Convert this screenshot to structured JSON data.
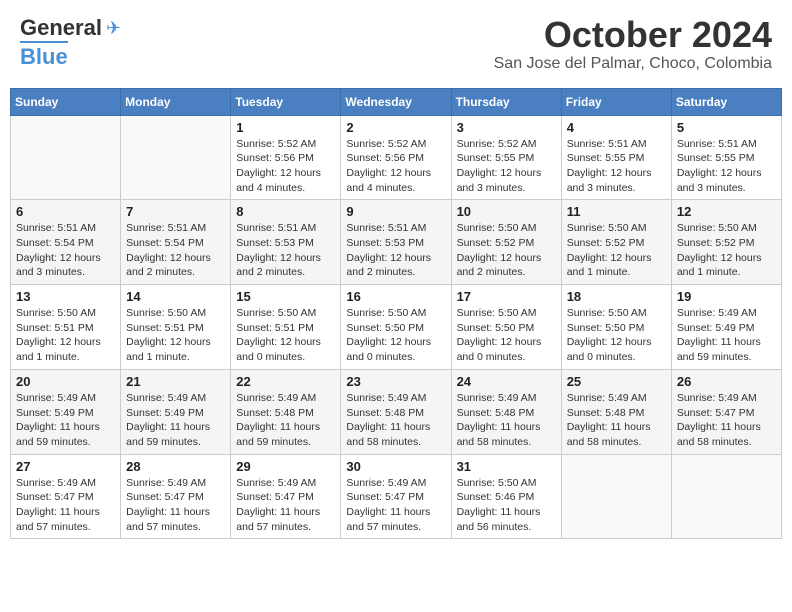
{
  "logo": {
    "line1": "General",
    "line2": "Blue"
  },
  "title": "October 2024",
  "subtitle": "San Jose del Palmar, Choco, Colombia",
  "days_of_week": [
    "Sunday",
    "Monday",
    "Tuesday",
    "Wednesday",
    "Thursday",
    "Friday",
    "Saturday"
  ],
  "weeks": [
    [
      {
        "day": "",
        "info": ""
      },
      {
        "day": "",
        "info": ""
      },
      {
        "day": "1",
        "info": "Sunrise: 5:52 AM\nSunset: 5:56 PM\nDaylight: 12 hours\nand 4 minutes."
      },
      {
        "day": "2",
        "info": "Sunrise: 5:52 AM\nSunset: 5:56 PM\nDaylight: 12 hours\nand 4 minutes."
      },
      {
        "day": "3",
        "info": "Sunrise: 5:52 AM\nSunset: 5:55 PM\nDaylight: 12 hours\nand 3 minutes."
      },
      {
        "day": "4",
        "info": "Sunrise: 5:51 AM\nSunset: 5:55 PM\nDaylight: 12 hours\nand 3 minutes."
      },
      {
        "day": "5",
        "info": "Sunrise: 5:51 AM\nSunset: 5:55 PM\nDaylight: 12 hours\nand 3 minutes."
      }
    ],
    [
      {
        "day": "6",
        "info": "Sunrise: 5:51 AM\nSunset: 5:54 PM\nDaylight: 12 hours\nand 3 minutes."
      },
      {
        "day": "7",
        "info": "Sunrise: 5:51 AM\nSunset: 5:54 PM\nDaylight: 12 hours\nand 2 minutes."
      },
      {
        "day": "8",
        "info": "Sunrise: 5:51 AM\nSunset: 5:53 PM\nDaylight: 12 hours\nand 2 minutes."
      },
      {
        "day": "9",
        "info": "Sunrise: 5:51 AM\nSunset: 5:53 PM\nDaylight: 12 hours\nand 2 minutes."
      },
      {
        "day": "10",
        "info": "Sunrise: 5:50 AM\nSunset: 5:52 PM\nDaylight: 12 hours\nand 2 minutes."
      },
      {
        "day": "11",
        "info": "Sunrise: 5:50 AM\nSunset: 5:52 PM\nDaylight: 12 hours\nand 1 minute."
      },
      {
        "day": "12",
        "info": "Sunrise: 5:50 AM\nSunset: 5:52 PM\nDaylight: 12 hours\nand 1 minute."
      }
    ],
    [
      {
        "day": "13",
        "info": "Sunrise: 5:50 AM\nSunset: 5:51 PM\nDaylight: 12 hours\nand 1 minute."
      },
      {
        "day": "14",
        "info": "Sunrise: 5:50 AM\nSunset: 5:51 PM\nDaylight: 12 hours\nand 1 minute."
      },
      {
        "day": "15",
        "info": "Sunrise: 5:50 AM\nSunset: 5:51 PM\nDaylight: 12 hours\nand 0 minutes."
      },
      {
        "day": "16",
        "info": "Sunrise: 5:50 AM\nSunset: 5:50 PM\nDaylight: 12 hours\nand 0 minutes."
      },
      {
        "day": "17",
        "info": "Sunrise: 5:50 AM\nSunset: 5:50 PM\nDaylight: 12 hours\nand 0 minutes."
      },
      {
        "day": "18",
        "info": "Sunrise: 5:50 AM\nSunset: 5:50 PM\nDaylight: 12 hours\nand 0 minutes."
      },
      {
        "day": "19",
        "info": "Sunrise: 5:49 AM\nSunset: 5:49 PM\nDaylight: 11 hours\nand 59 minutes."
      }
    ],
    [
      {
        "day": "20",
        "info": "Sunrise: 5:49 AM\nSunset: 5:49 PM\nDaylight: 11 hours\nand 59 minutes."
      },
      {
        "day": "21",
        "info": "Sunrise: 5:49 AM\nSunset: 5:49 PM\nDaylight: 11 hours\nand 59 minutes."
      },
      {
        "day": "22",
        "info": "Sunrise: 5:49 AM\nSunset: 5:48 PM\nDaylight: 11 hours\nand 59 minutes."
      },
      {
        "day": "23",
        "info": "Sunrise: 5:49 AM\nSunset: 5:48 PM\nDaylight: 11 hours\nand 58 minutes."
      },
      {
        "day": "24",
        "info": "Sunrise: 5:49 AM\nSunset: 5:48 PM\nDaylight: 11 hours\nand 58 minutes."
      },
      {
        "day": "25",
        "info": "Sunrise: 5:49 AM\nSunset: 5:48 PM\nDaylight: 11 hours\nand 58 minutes."
      },
      {
        "day": "26",
        "info": "Sunrise: 5:49 AM\nSunset: 5:47 PM\nDaylight: 11 hours\nand 58 minutes."
      }
    ],
    [
      {
        "day": "27",
        "info": "Sunrise: 5:49 AM\nSunset: 5:47 PM\nDaylight: 11 hours\nand 57 minutes."
      },
      {
        "day": "28",
        "info": "Sunrise: 5:49 AM\nSunset: 5:47 PM\nDaylight: 11 hours\nand 57 minutes."
      },
      {
        "day": "29",
        "info": "Sunrise: 5:49 AM\nSunset: 5:47 PM\nDaylight: 11 hours\nand 57 minutes."
      },
      {
        "day": "30",
        "info": "Sunrise: 5:49 AM\nSunset: 5:47 PM\nDaylight: 11 hours\nand 57 minutes."
      },
      {
        "day": "31",
        "info": "Sunrise: 5:50 AM\nSunset: 5:46 PM\nDaylight: 11 hours\nand 56 minutes."
      },
      {
        "day": "",
        "info": ""
      },
      {
        "day": "",
        "info": ""
      }
    ]
  ]
}
